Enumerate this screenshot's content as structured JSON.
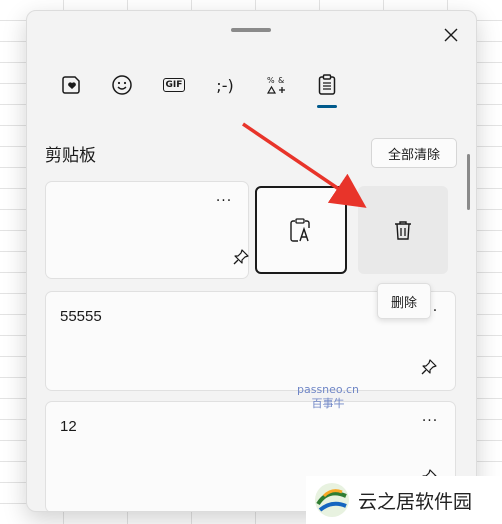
{
  "panel": {
    "tabs": [
      {
        "name": "emoji-heart",
        "label": ""
      },
      {
        "name": "emoji-smile",
        "label": ""
      },
      {
        "name": "gif",
        "label": "GIF"
      },
      {
        "name": "kaomoji",
        "label": ";-)"
      },
      {
        "name": "symbols",
        "label": ""
      },
      {
        "name": "clipboard",
        "label": ""
      }
    ],
    "active_tab": "clipboard",
    "section_title": "剪贴板",
    "clear_all_label": "全部清除"
  },
  "clipboard_items": [
    {
      "text": "",
      "more": "···"
    },
    {
      "text": "55555",
      "more": "···"
    },
    {
      "text": "12",
      "more": "···"
    }
  ],
  "tooltip": {
    "label": "删除"
  },
  "watermark": {
    "line1": "passneo.cn",
    "line2": "百事牛"
  },
  "corner_logo": {
    "text": "云之居软件园"
  },
  "colors": {
    "accent": "#005a8c",
    "arrow": "#e8342a"
  }
}
